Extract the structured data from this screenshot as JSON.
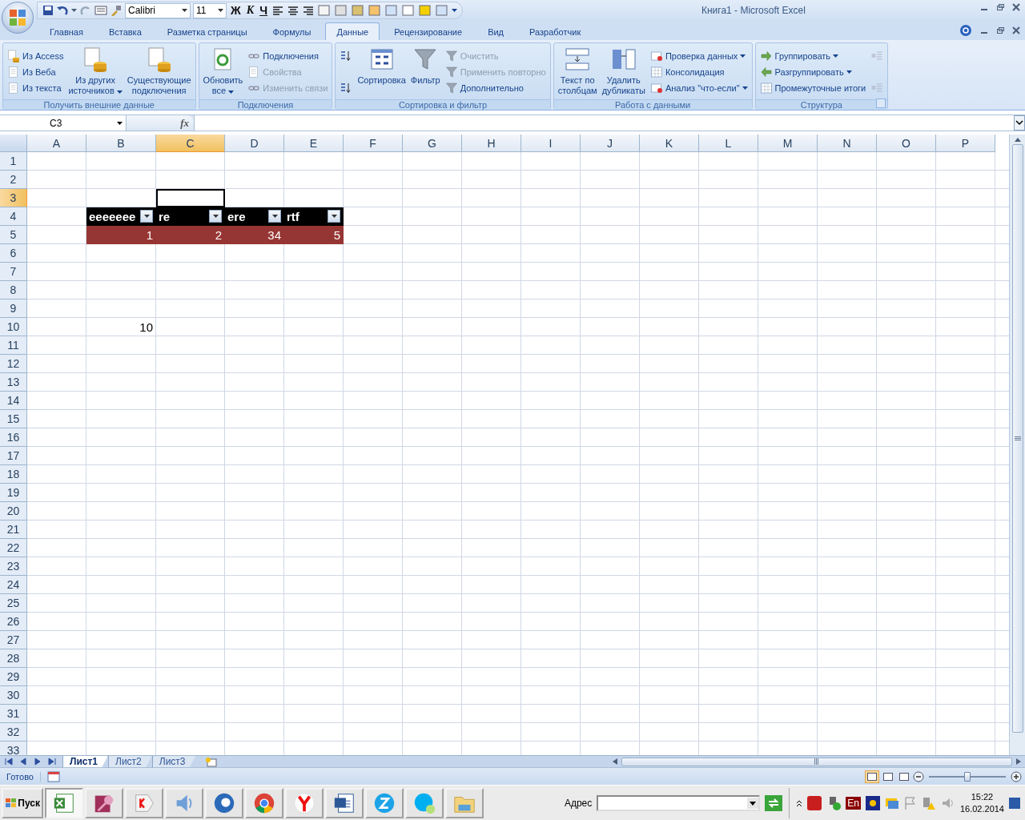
{
  "window": {
    "title": "Книга1 - Microsoft Excel"
  },
  "quick_access": {
    "font": "Calibri",
    "size": "11",
    "format_buttons": [
      {
        "label": "Ж",
        "kind": "bold"
      },
      {
        "label": "К",
        "kind": "italic"
      },
      {
        "label": "Ч",
        "kind": "underline"
      }
    ]
  },
  "ribbon": {
    "tabs": [
      {
        "label": "Главная",
        "selected": false
      },
      {
        "label": "Вставка",
        "selected": false
      },
      {
        "label": "Разметка страницы",
        "selected": false
      },
      {
        "label": "Формулы",
        "selected": false
      },
      {
        "label": "Данные",
        "selected": true
      },
      {
        "label": "Рецензирование",
        "selected": false
      },
      {
        "label": "Вид",
        "selected": false
      },
      {
        "label": "Разработчик",
        "selected": false
      }
    ],
    "groups": [
      {
        "title": "Получить внешние данные",
        "commands": [
          {
            "kind": "small",
            "label": "Из Access",
            "disabled": false,
            "dropdown": false
          },
          {
            "kind": "small",
            "label": "Из Веба",
            "disabled": false,
            "dropdown": false
          },
          {
            "kind": "small",
            "label": "Из текста",
            "disabled": false,
            "dropdown": false
          },
          {
            "kind": "large",
            "lines": [
              "Из других",
              "источников"
            ],
            "disabled": false,
            "dropdown": true
          },
          {
            "kind": "large",
            "lines": [
              "Существующие",
              "подключения"
            ],
            "disabled": false,
            "dropdown": false
          }
        ]
      },
      {
        "title": "Подключения",
        "commands": [
          {
            "kind": "large",
            "lines": [
              "Обновить",
              "все"
            ],
            "disabled": false,
            "dropdown": true
          },
          {
            "kind": "small",
            "label": "Подключения",
            "disabled": false,
            "dropdown": false
          },
          {
            "kind": "small",
            "label": "Свойства",
            "disabled": true,
            "dropdown": false
          },
          {
            "kind": "small",
            "label": "Изменить связи",
            "disabled": true,
            "dropdown": false
          }
        ]
      },
      {
        "title": "Сортировка и фильтр",
        "commands": [
          {
            "kind": "icon",
            "disabled": false
          },
          {
            "kind": "icon",
            "disabled": false
          },
          {
            "kind": "large",
            "lines": [
              "Сортировка"
            ],
            "disabled": false,
            "dropdown": false
          },
          {
            "kind": "large",
            "lines": [
              "Фильтр"
            ],
            "disabled": false,
            "dropdown": false
          },
          {
            "kind": "small",
            "label": "Очистить",
            "disabled": true,
            "dropdown": false
          },
          {
            "kind": "small",
            "label": "Применить повторно",
            "disabled": true,
            "dropdown": false
          },
          {
            "kind": "small",
            "label": "Дополнительно",
            "disabled": false,
            "dropdown": false
          }
        ]
      },
      {
        "title": "Работа с данными",
        "commands": [
          {
            "kind": "large",
            "lines": [
              "Текст по",
              "столбцам"
            ],
            "disabled": false,
            "dropdown": false
          },
          {
            "kind": "large",
            "lines": [
              "Удалить",
              "дубликаты"
            ],
            "disabled": false,
            "dropdown": false
          },
          {
            "kind": "small",
            "label": "Проверка данных",
            "disabled": false,
            "dropdown": true
          },
          {
            "kind": "small",
            "label": "Консолидация",
            "disabled": false,
            "dropdown": false
          },
          {
            "kind": "small",
            "label": "Анализ \"что-если\"",
            "disabled": false,
            "dropdown": true
          }
        ]
      },
      {
        "title": "Структура",
        "launcher": true,
        "commands": [
          {
            "kind": "small",
            "label": "Группировать",
            "disabled": false,
            "dropdown": true
          },
          {
            "kind": "small",
            "label": "Разгруппировать",
            "disabled": false,
            "dropdown": true
          },
          {
            "kind": "small",
            "label": "Промежуточные итоги",
            "disabled": false,
            "dropdown": false
          },
          {
            "kind": "icon",
            "disabled": true
          },
          {
            "kind": "icon",
            "disabled": true
          }
        ]
      }
    ]
  },
  "formula_bar": {
    "name_box": "C3",
    "function_label": "fx"
  },
  "sheet": {
    "columns": [
      {
        "label": "A",
        "selected": false
      },
      {
        "label": "B",
        "selected": false
      },
      {
        "label": "C",
        "selected": true
      },
      {
        "label": "D",
        "selected": false
      },
      {
        "label": "E",
        "selected": false
      },
      {
        "label": "F",
        "selected": false
      },
      {
        "label": "G",
        "selected": false
      },
      {
        "label": "H",
        "selected": false
      },
      {
        "label": "I",
        "selected": false
      },
      {
        "label": "J",
        "selected": false
      },
      {
        "label": "K",
        "selected": false
      },
      {
        "label": "L",
        "selected": false
      },
      {
        "label": "M",
        "selected": false
      },
      {
        "label": "N",
        "selected": false
      },
      {
        "label": "O",
        "selected": false
      },
      {
        "label": "P",
        "selected": false
      }
    ],
    "rows": [
      {
        "label": "1",
        "selected": false
      },
      {
        "label": "2",
        "selected": false
      },
      {
        "label": "3",
        "selected": true
      },
      {
        "label": "4",
        "selected": false
      },
      {
        "label": "5",
        "selected": false
      },
      {
        "label": "6",
        "selected": false
      },
      {
        "label": "7",
        "selected": false
      },
      {
        "label": "8",
        "selected": false
      },
      {
        "label": "9",
        "selected": false
      },
      {
        "label": "10",
        "selected": false
      },
      {
        "label": "11",
        "selected": false
      },
      {
        "label": "12",
        "selected": false
      },
      {
        "label": "13",
        "selected": false
      },
      {
        "label": "14",
        "selected": false
      },
      {
        "label": "15",
        "selected": false
      },
      {
        "label": "16",
        "selected": false
      },
      {
        "label": "17",
        "selected": false
      },
      {
        "label": "18",
        "selected": false
      },
      {
        "label": "19",
        "selected": false
      },
      {
        "label": "20",
        "selected": false
      },
      {
        "label": "21",
        "selected": false
      },
      {
        "label": "22",
        "selected": false
      },
      {
        "label": "23",
        "selected": false
      },
      {
        "label": "24",
        "selected": false
      },
      {
        "label": "25",
        "selected": false
      },
      {
        "label": "26",
        "selected": false
      },
      {
        "label": "27",
        "selected": false
      },
      {
        "label": "28",
        "selected": false
      },
      {
        "label": "29",
        "selected": false
      },
      {
        "label": "30",
        "selected": false
      },
      {
        "label": "31",
        "selected": false
      },
      {
        "label": "32",
        "selected": false
      },
      {
        "label": "33",
        "selected": false
      }
    ],
    "table": {
      "headers": [
        "eeeeeee",
        "re",
        "ere",
        "rtf"
      ],
      "values": [
        "1",
        "2",
        "34",
        "5"
      ]
    },
    "cells": [
      {
        "value": "10"
      }
    ]
  },
  "sheet_tabs": [
    {
      "label": "Лист1",
      "selected": true
    },
    {
      "label": "Лист2",
      "selected": false
    },
    {
      "label": "Лист3",
      "selected": false
    }
  ],
  "status_bar": {
    "status": "Готово",
    "zoom": {
      "level": 0.5
    }
  },
  "taskbar": {
    "start": "Пуск",
    "apps": [
      {
        "kind": "excel",
        "selected": true
      },
      {
        "kind": "access",
        "selected": false
      },
      {
        "kind": "yandex",
        "selected": false
      },
      {
        "kind": "sound",
        "selected": false
      },
      {
        "kind": "sphere",
        "selected": false
      },
      {
        "kind": "chrome",
        "selected": false
      },
      {
        "kind": "browser",
        "selected": false
      },
      {
        "kind": "word",
        "selected": false
      },
      {
        "kind": "zona",
        "selected": false
      },
      {
        "kind": "skype",
        "selected": false
      },
      {
        "kind": "folder",
        "selected": false
      }
    ],
    "address_label": "Адрес",
    "language": "En",
    "time": "15:22",
    "date": "16.02.2014"
  }
}
